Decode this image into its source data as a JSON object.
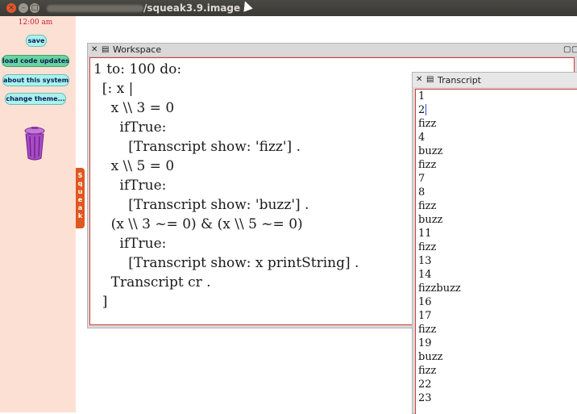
{
  "os": {
    "title": "/home/user/squeak3.9.image",
    "title_suffix": "squeak3.9.image"
  },
  "flap": {
    "clock": "12:00 am",
    "buttons": [
      {
        "label": "save"
      },
      {
        "label": "load code updates"
      },
      {
        "label": "about this system"
      },
      {
        "label": "change theme..."
      }
    ],
    "tab_label": "Squeak"
  },
  "workspace": {
    "title": "Workspace",
    "code_lines": [
      "1 to: 100 do:",
      "  [: x |",
      "    x \\\\ 3 = 0",
      "      ifTrue:",
      "        [Transcript show: 'fizz'] .",
      "    x \\\\ 5 = 0",
      "      ifTrue:",
      "        [Transcript show: 'buzz'] .",
      "    (x \\\\ 3 ~= 0) & (x \\\\ 5 ~= 0)",
      "      ifTrue:",
      "        [Transcript show: x printString] .",
      "    Transcript cr .",
      "  ]"
    ]
  },
  "transcript": {
    "title": "Transcript",
    "lines": [
      "1",
      "2",
      "fizz",
      "4",
      "buzz",
      "fizz",
      "7",
      "8",
      "fizz",
      "buzz",
      "11",
      "fizz",
      "13",
      "14",
      "fizzbuzz",
      "16",
      "17",
      "fizz",
      "19",
      "buzz",
      "fizz",
      "22",
      "23"
    ]
  }
}
